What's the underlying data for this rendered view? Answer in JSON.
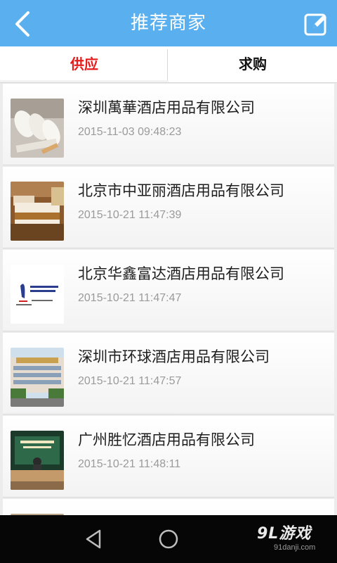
{
  "header": {
    "title": "推荐商家",
    "back_icon": "chevron-left-icon",
    "edit_icon": "edit-icon",
    "background": "#5ab0ee"
  },
  "tabs": [
    {
      "label": "供应",
      "active": true
    },
    {
      "label": "求购",
      "active": false
    }
  ],
  "accent_color": "#e51c1c",
  "companies": [
    {
      "name": "深圳萬華酒店用品有限公司",
      "time": "2015-11-03 09:48:23",
      "thumb": "slippers-photo"
    },
    {
      "name": "北京市中亚丽酒店用品有限公司",
      "time": "2015-10-21 11:47:39",
      "thumb": "hotel-bed-photo"
    },
    {
      "name": "北京华鑫富达酒店用品有限公司",
      "time": "2015-10-21 11:47:47",
      "thumb": "logo-image"
    },
    {
      "name": "深圳市环球酒店用品有限公司",
      "time": "2015-10-21 11:47:57",
      "thumb": "building-photo"
    },
    {
      "name": "广州胜忆酒店用品有限公司",
      "time": "2015-10-21 11:48:11",
      "thumb": "office-photo"
    }
  ],
  "navbar": {
    "back_icon": "triangle-back-icon",
    "home_icon": "circle-home-icon",
    "watermark_main": "9L游戏",
    "watermark_sub": "91danji.com"
  }
}
